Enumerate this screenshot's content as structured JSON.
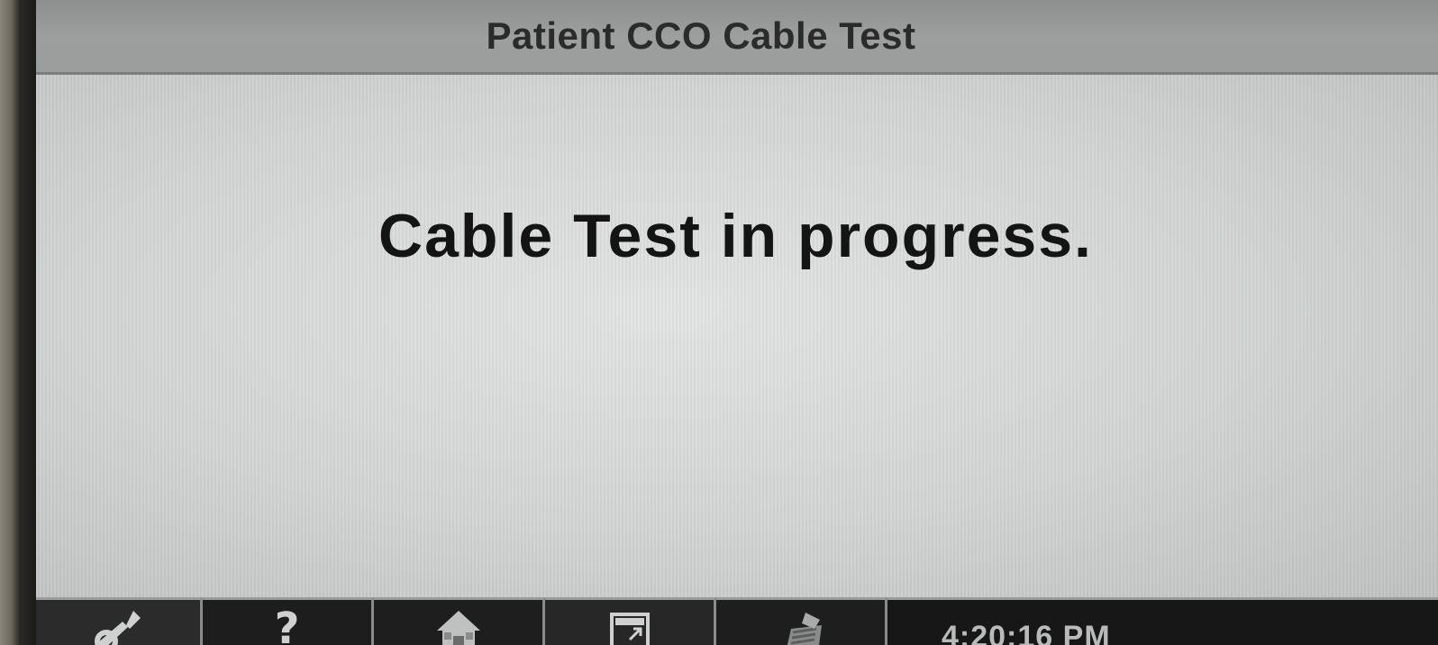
{
  "title_bar": {
    "title": "Patient CCO Cable Test"
  },
  "content": {
    "message": "Cable Test in progress."
  },
  "footer": {
    "buttons": [
      {
        "id": "tools",
        "icon": "wrench-icon"
      },
      {
        "id": "help",
        "icon": "question-icon",
        "label": "?"
      },
      {
        "id": "home",
        "icon": "home-icon"
      },
      {
        "id": "screen",
        "icon": "screen-expand-icon"
      },
      {
        "id": "print",
        "icon": "printer-icon"
      }
    ],
    "clock": "4:20:16 PM"
  },
  "colors": {
    "title_bar_bg": "#9a9d9c",
    "content_bg": "#d6d9d8",
    "footer_bg": "#1c1d1c",
    "text": "#141414"
  }
}
